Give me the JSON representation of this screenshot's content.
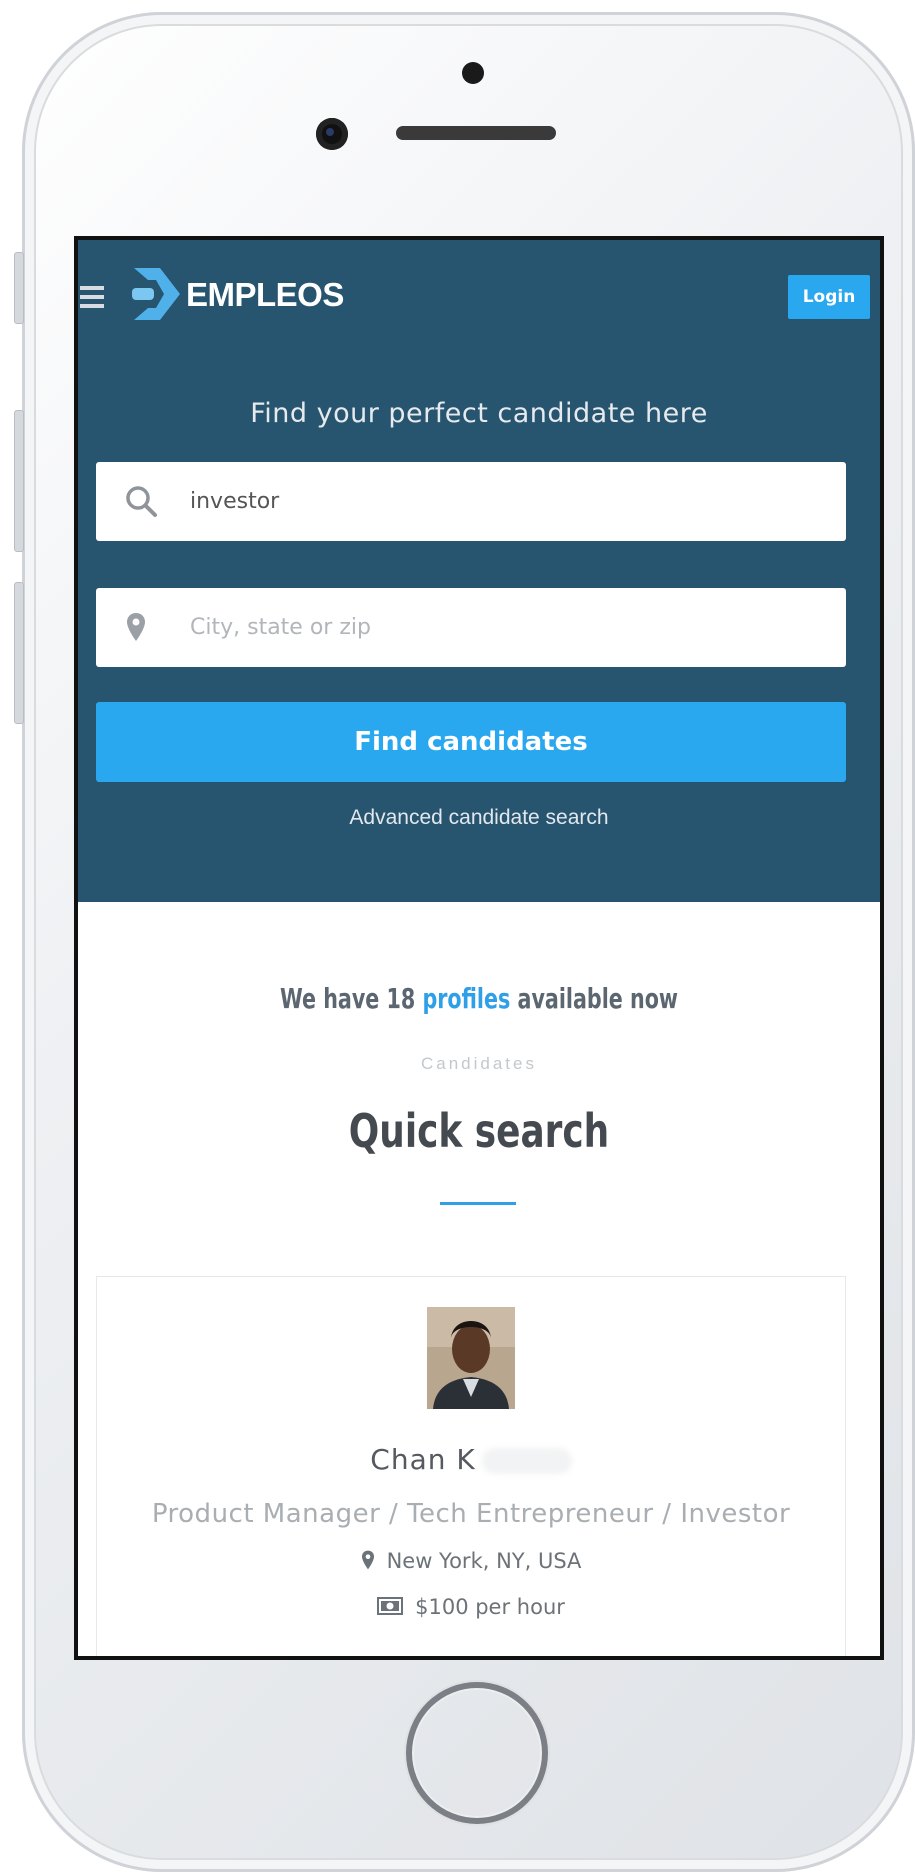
{
  "brand": {
    "name": "EMPLEOS"
  },
  "nav": {
    "login_label": "Login"
  },
  "hero": {
    "title": "Find your perfect candidate here",
    "search_value": "investor",
    "location_placeholder": "City, state or zip",
    "find_button": "Find candidates",
    "advanced_link": "Advanced candidate search"
  },
  "section": {
    "profiles_prefix": "We have 18",
    "profiles_highlight": "profiles",
    "profiles_suffix": "available now",
    "eyebrow": "Candidates",
    "heading": "Quick search"
  },
  "candidate": {
    "name": "Chan K",
    "title": "Product Manager / Tech Entrepreneur / Investor",
    "location": "New York, NY, USA",
    "rate": "$100 per hour"
  },
  "colors": {
    "hero_bg": "#27546f",
    "accent": "#29a8f0"
  }
}
